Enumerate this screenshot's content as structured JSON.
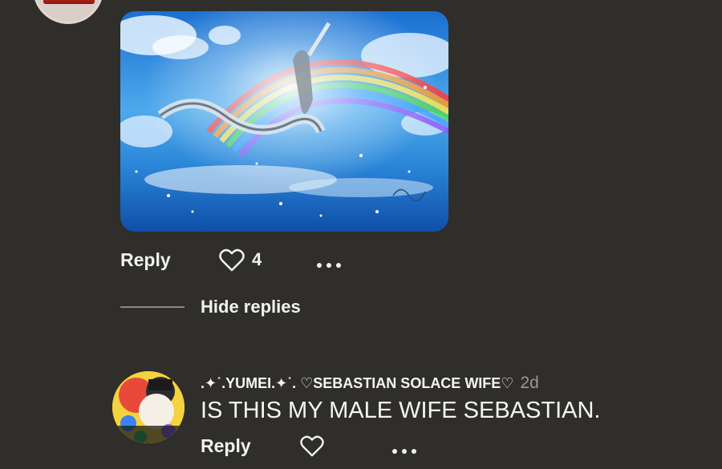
{
  "thread": {
    "top_comment": {
      "like_count": "4",
      "reply_label": "Reply",
      "more_icon": "ellipsis-icon",
      "like_icon": "heart-outline-icon",
      "image_icon": "artwork-image"
    },
    "hide_replies_label": "Hide replies",
    "reply_comment": {
      "username": ".✦˙.YUMEI.✦˙. ♡SEBASTIAN SOLACE WIFE♡",
      "time_ago": "2d",
      "text": "IS THIS MY MALE WIFE SEBASTIAN.",
      "reply_label": "Reply",
      "like_icon": "heart-outline-icon",
      "more_icon": "ellipsis-icon"
    }
  },
  "colors": {
    "background": "#2f2e2b",
    "text": "#f2f2f2",
    "muted": "#9a9893"
  }
}
